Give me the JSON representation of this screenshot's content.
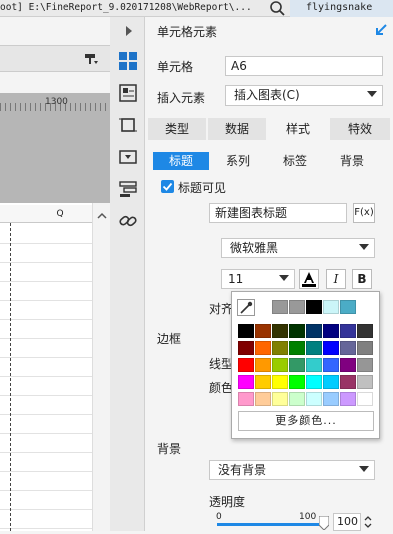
{
  "titlebar": {
    "path": "oot] E:\\FineReport_9.020171208\\WebReport\\...",
    "user": "flyingsnake"
  },
  "sheet": {
    "ruler_label": "1300",
    "column_header": "Q"
  },
  "panel": {
    "header": "单元格元素",
    "cell_label": "单元格",
    "cell_value": "A6",
    "insert_label": "插入元素",
    "insert_value": "插入图表(C)",
    "tabs": [
      "类型",
      "数据",
      "样式",
      "特效"
    ],
    "active_tab": "样式",
    "subtabs": [
      "标题",
      "系列",
      "标签",
      "背景"
    ],
    "active_subtab": "标题",
    "title_visible_label": "标题可见",
    "title_visible_checked": true,
    "title_text": "新建图表标题",
    "formula_button": "F(x)",
    "font_family": "微软雅黑",
    "font_size": "11",
    "italic_label": "I",
    "bold_label": "B",
    "align_label": "对齐",
    "border_section": "边框",
    "line_type_label": "线型",
    "color_label": "颜色",
    "background_section": "背景",
    "background_value": "没有背景",
    "opacity_label": "透明度",
    "opacity_min": "0",
    "opacity_max": "100",
    "opacity_value": "100"
  },
  "color_popup": {
    "more_colors": "更多颜色...",
    "recent": [
      "#999999",
      "#999999",
      "#000000",
      "#cbf5f8",
      "#4bacc6"
    ],
    "grid": [
      [
        "#000000",
        "#993300",
        "#333300",
        "#003300",
        "#003366",
        "#000080",
        "#333399",
        "#333333"
      ],
      [
        "#800000",
        "#ff6600",
        "#808000",
        "#008000",
        "#008080",
        "#0000ff",
        "#666699",
        "#808080"
      ],
      [
        "#ff0000",
        "#ff9900",
        "#99cc00",
        "#339966",
        "#33cccc",
        "#3366ff",
        "#800080",
        "#969696"
      ],
      [
        "#ff00ff",
        "#ffcc00",
        "#ffff00",
        "#00ff00",
        "#00ffff",
        "#00ccff",
        "#993366",
        "#c0c0c0"
      ],
      [
        "#ff99cc",
        "#ffcc99",
        "#ffff99",
        "#ccffcc",
        "#ccffff",
        "#99ccff",
        "#cc99ff",
        "#ffffff"
      ]
    ]
  },
  "colors": {
    "accent_blue": "#1e88e5",
    "active_subtab": "#1e88e5"
  }
}
